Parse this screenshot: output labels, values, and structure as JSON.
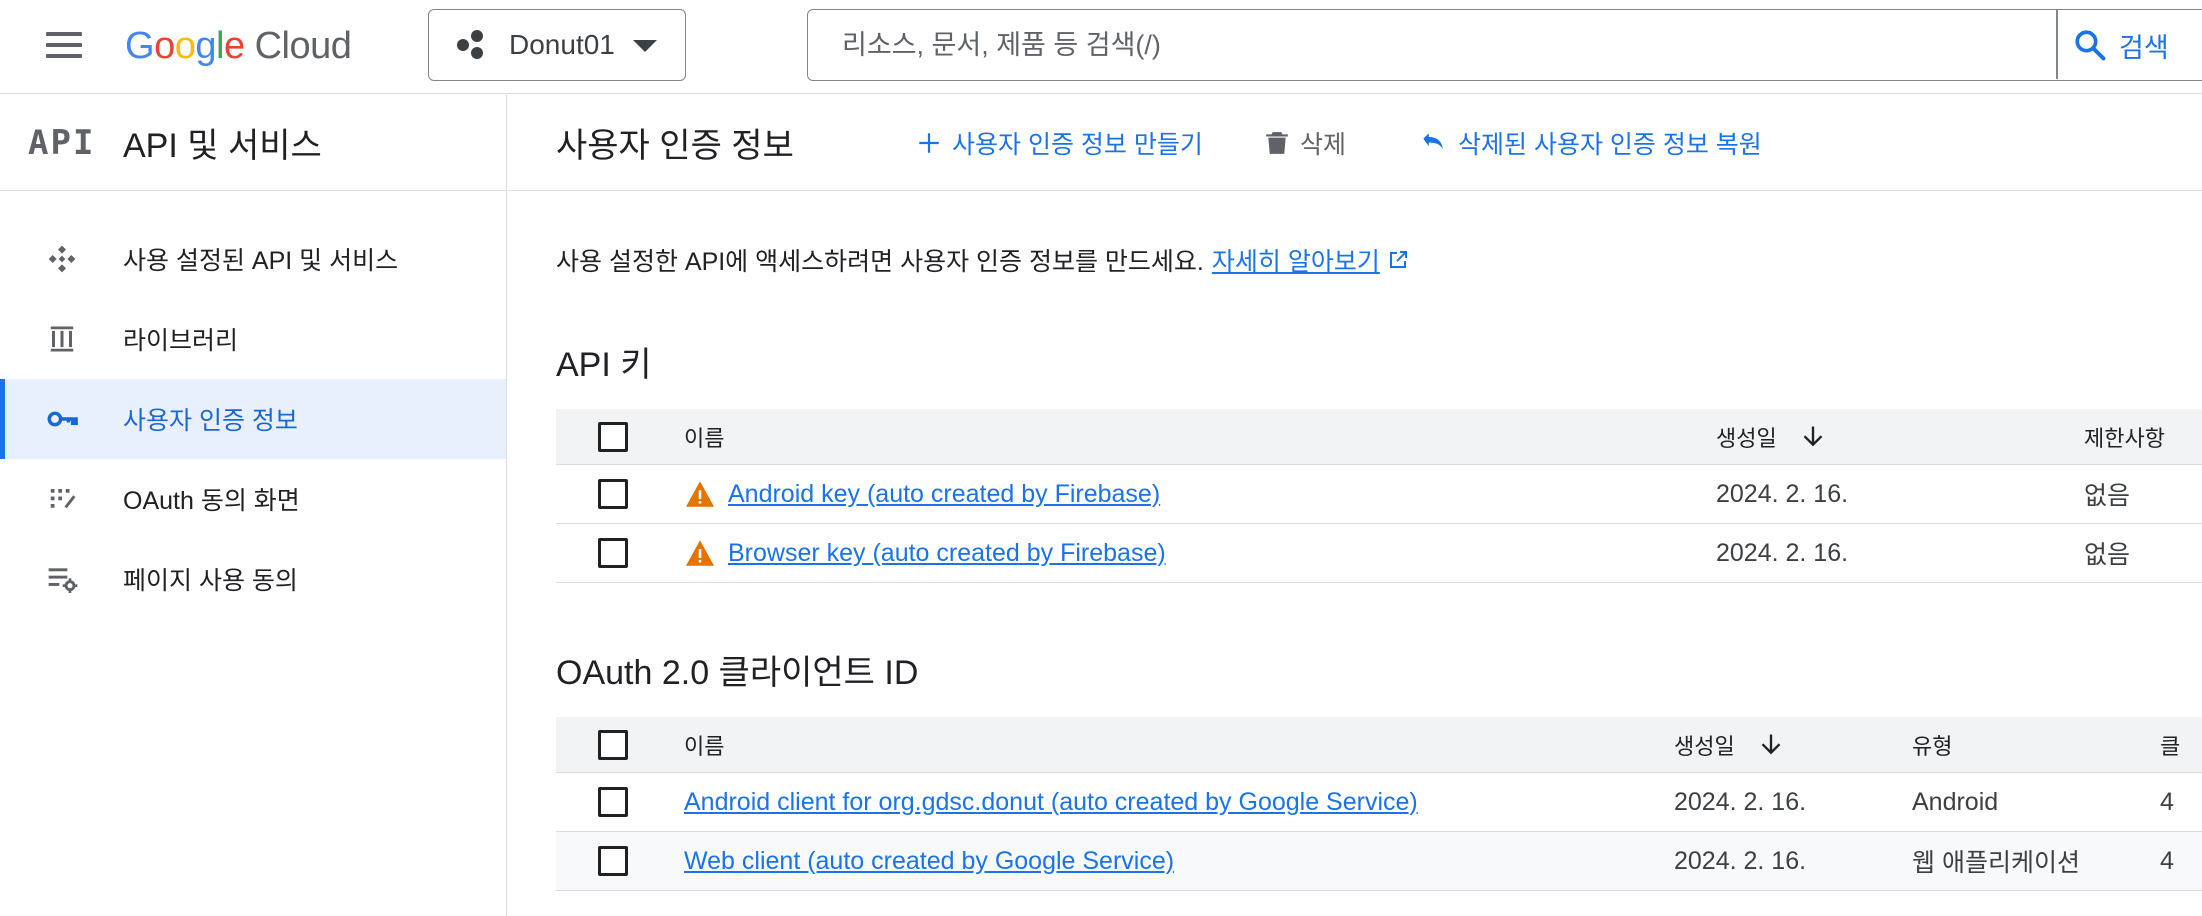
{
  "topbar": {
    "logo": {
      "G": "G",
      "o1": "o",
      "o2": "o",
      "g": "g",
      "l": "l",
      "e": "e",
      "cloud": "Cloud"
    },
    "project_name": "Donut01",
    "search_placeholder": "리소스, 문서, 제품 등 검색(/)",
    "search_button_label": "검색"
  },
  "sidebar": {
    "logo_text": "API",
    "title": "API 및 서비스",
    "items": [
      {
        "label": "사용 설정된 API 및 서비스",
        "icon": "api-services-icon",
        "active": false
      },
      {
        "label": "라이브러리",
        "icon": "library-icon",
        "active": false
      },
      {
        "label": "사용자 인증 정보",
        "icon": "key-icon",
        "active": true
      },
      {
        "label": "OAuth 동의 화면",
        "icon": "oauth-consent-icon",
        "active": false
      },
      {
        "label": "페이지 사용 동의",
        "icon": "page-usage-settings-icon",
        "active": false
      }
    ]
  },
  "main": {
    "title": "사용자 인증 정보",
    "actions": {
      "create": "사용자 인증 정보 만들기",
      "delete": "삭제",
      "restore": "삭제된 사용자 인증 정보 복원"
    },
    "intro_text": "사용 설정한 API에 액세스하려면 사용자 인증 정보를 만드세요.",
    "learn_more": "자세히 알아보기",
    "api_keys": {
      "title": "API 키",
      "columns": {
        "name": "이름",
        "created": "생성일",
        "restrictions": "제한사항"
      },
      "rows": [
        {
          "name": "Android key (auto created by Firebase)",
          "created": "2024. 2. 16.",
          "restrictions": "없음"
        },
        {
          "name": "Browser key (auto created by Firebase)",
          "created": "2024. 2. 16.",
          "restrictions": "없음"
        }
      ]
    },
    "oauth": {
      "title": "OAuth 2.0 클라이언트 ID",
      "columns": {
        "name": "이름",
        "created": "생성일",
        "type": "유형",
        "client_id_partial": "클"
      },
      "rows": [
        {
          "name": "Android client for org.gdsc.donut (auto created by Google Service)",
          "created": "2024. 2. 16.",
          "type": "Android",
          "client_id_partial": "4"
        },
        {
          "name": "Web client (auto created by Google Service)",
          "created": "2024. 2. 16.",
          "type": "웹 애플리케이션",
          "client_id_partial": "4"
        }
      ]
    }
  },
  "colors": {
    "accent": "#1a73e8",
    "active_bg": "#e8f0fe",
    "warning": "#e37400",
    "header_row_bg": "#f1f3f4"
  }
}
